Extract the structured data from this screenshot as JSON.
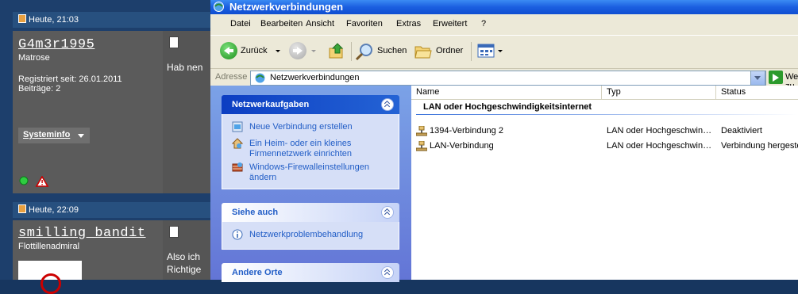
{
  "forum": {
    "posts": [
      {
        "timestamp": "Heute, 21:03",
        "username": "G4m3r1995",
        "rank": "Matrose",
        "registered": "Registriert seit: 26.01.2011",
        "posts_count": "Beiträge: 2",
        "sysinfo_label": "Systeminfo",
        "text": "Hab nen"
      },
      {
        "timestamp": "Heute, 22:09",
        "username": "smilling_bandit",
        "rank": "Flottillenadmiral",
        "text_line1": "Also ich",
        "text_line2": "Richtige"
      }
    ]
  },
  "window": {
    "title": "Netzwerkverbindungen",
    "menu": [
      "Datei",
      "Bearbeiten",
      "Ansicht",
      "Favoriten",
      "Extras",
      "Erweitert",
      "?"
    ],
    "toolbar": {
      "back": "Zurück",
      "search": "Suchen",
      "folders": "Ordner"
    },
    "address": {
      "label": "Adresse",
      "value": "Netzwerkverbindungen",
      "go": "Wechseln zu"
    },
    "tasks": {
      "title": "Netzwerkaufgaben",
      "items": [
        "Neue Verbindung erstellen",
        "Ein Heim- oder ein kleines Firmennetzwerk einrichten",
        "Windows-Firewalleinstellungen ändern"
      ]
    },
    "see_also": {
      "title": "Siehe auch",
      "items": [
        "Netzwerkproblembehandlung"
      ]
    },
    "other_places": {
      "title": "Andere Orte"
    },
    "list": {
      "columns": [
        "Name",
        "Typ",
        "Status"
      ],
      "group": "LAN oder Hochgeschwindigkeitsinternet",
      "rows": [
        {
          "name": "1394-Verbindung 2",
          "type": "LAN oder Hochgeschwin…",
          "status": "Deaktiviert"
        },
        {
          "name": "LAN-Verbindung",
          "type": "LAN oder Hochgeschwin…",
          "status": "Verbindung hergestellt"
        }
      ]
    }
  }
}
